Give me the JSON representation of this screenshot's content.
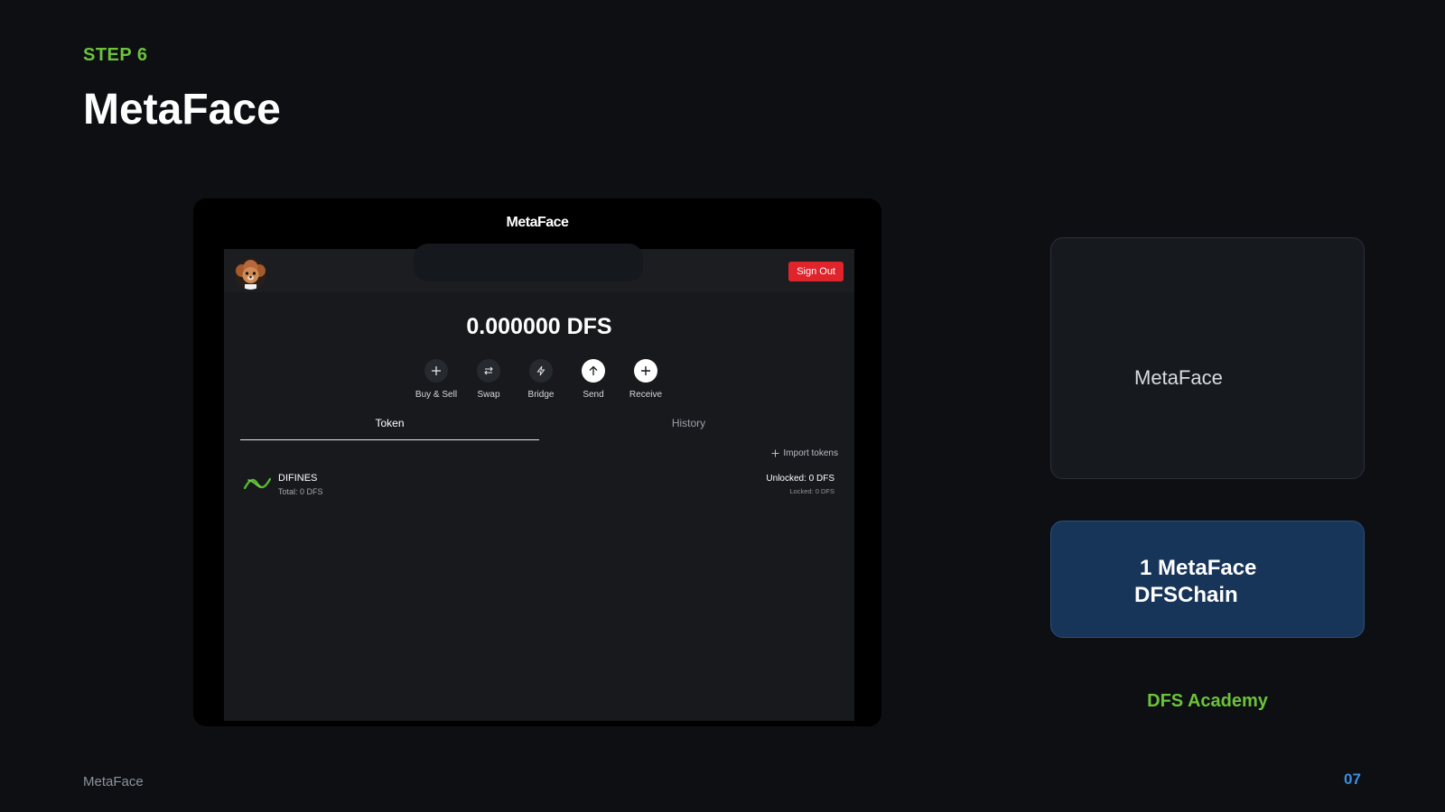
{
  "slide": {
    "step_label": "STEP 6",
    "title": "MetaFace",
    "footer_left": "MetaFace",
    "page_number": "07"
  },
  "device": {
    "brand": "MetaFace",
    "header": {
      "avatar_icon": "dog-avatar-icon",
      "sign_out_label": "Sign Out",
      "sign_out_color": "#e0242c"
    },
    "balance": "0.000000 DFS",
    "actions": [
      {
        "label": "Buy & Sell",
        "icon": "plus-icon"
      },
      {
        "label": "Swap",
        "icon": "swap-icon"
      },
      {
        "label": "Bridge",
        "icon": "bolt-icon"
      },
      {
        "label": "Send",
        "icon": "arrow-up-icon"
      },
      {
        "label": "Receive",
        "icon": "plus-icon"
      }
    ],
    "tabs": [
      {
        "label": "Token",
        "active": true
      },
      {
        "label": "History",
        "active": false
      }
    ],
    "import_tokens_label": "Import tokens",
    "tokens": [
      {
        "name": "DIFINES",
        "total": "Total: 0 DFS",
        "unlocked": "Unlocked: 0 DFS",
        "locked": "Locked: 0 DFS",
        "logo": "difines-logo-icon"
      }
    ]
  },
  "side_panel": {
    "card_top_text": "MetaFace",
    "card_bottom_line1": "1  MetaFace",
    "card_bottom_line2": "DFSChain",
    "academy_label": "DFS Academy",
    "accent_green": "#6cc33a",
    "accent_blue": "#3b8fe0"
  }
}
